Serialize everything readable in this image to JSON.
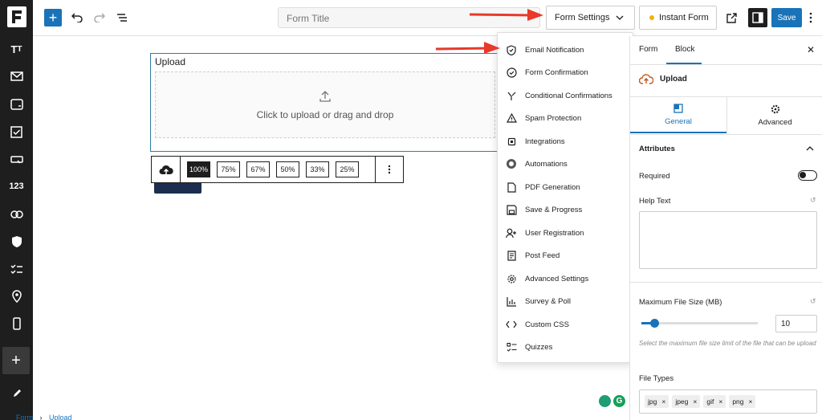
{
  "toolbar": {
    "form_title_placeholder": "Form Title",
    "form_settings_label": "Form Settings",
    "instant_form_label": "Instant Form",
    "save_label": "Save"
  },
  "rail": {
    "items": [
      "text-icon",
      "mail-icon",
      "input-icon",
      "checkbox-icon",
      "button-icon",
      "number-icon",
      "link-icon",
      "shield-icon",
      "checklist-icon",
      "location-icon",
      "mobile-icon"
    ],
    "number_label": "123"
  },
  "canvas": {
    "upload_label": "Upload",
    "dropzone_text": "Click to upload or drag and drop",
    "widths": [
      "100%",
      "75%",
      "67%",
      "50%",
      "33%",
      "25%"
    ],
    "active_width": "100%"
  },
  "menu": {
    "items": [
      {
        "label": "Email Notification",
        "icon": "shield-check-icon"
      },
      {
        "label": "Form Confirmation",
        "icon": "check-circle-icon"
      },
      {
        "label": "Conditional Confirmations",
        "icon": "branch-icon"
      },
      {
        "label": "Spam Protection",
        "icon": "warning-icon"
      },
      {
        "label": "Integrations",
        "icon": "chip-icon"
      },
      {
        "label": "Automations",
        "icon": "automation-icon"
      },
      {
        "label": "PDF Generation",
        "icon": "document-icon"
      },
      {
        "label": "Save & Progress",
        "icon": "save-icon"
      },
      {
        "label": "User Registration",
        "icon": "user-plus-icon"
      },
      {
        "label": "Post Feed",
        "icon": "post-icon"
      },
      {
        "label": "Advanced Settings",
        "icon": "gear-icon"
      },
      {
        "label": "Survey & Poll",
        "icon": "bar-chart-icon"
      },
      {
        "label": "Custom CSS",
        "icon": "code-icon"
      },
      {
        "label": "Quizzes",
        "icon": "quiz-icon"
      }
    ]
  },
  "panel": {
    "tab_form": "Form",
    "tab_block": "Block",
    "block_name": "Upload",
    "subtab_general": "General",
    "subtab_advanced": "Advanced",
    "section_attributes": "Attributes",
    "required_label": "Required",
    "help_text_label": "Help Text",
    "max_size_label": "Maximum File Size (MB)",
    "max_size_value": "10",
    "max_size_fraction": 0.1,
    "max_size_hint": "Select the maximum file size limit of the file that can be upload",
    "file_types_label": "File Types",
    "file_types": [
      "jpg",
      "jpeg",
      "gif",
      "png"
    ]
  },
  "breadcrumb": {
    "root": "Form",
    "sep": "›",
    "current": "Upload"
  },
  "colors": {
    "accent": "#1a73b8",
    "rail": "#1e1e1e",
    "arrow": "#e8392b"
  }
}
